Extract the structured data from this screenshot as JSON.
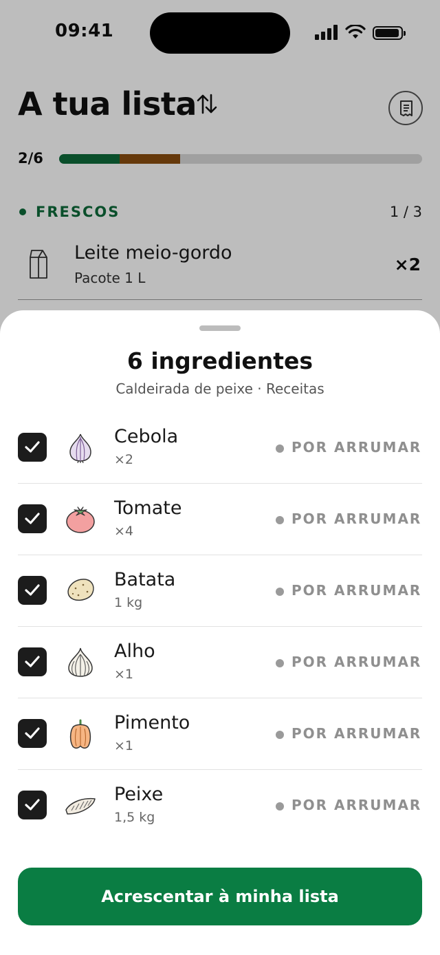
{
  "status_bar": {
    "time": "09:41"
  },
  "header": {
    "title": "A tua lista",
    "sort_icon": "sort-arrows-icon",
    "receipt_icon": "receipt-icon"
  },
  "progress": {
    "label": "2/6",
    "done_fraction": 0.167,
    "pending_fraction": 0.167
  },
  "section": {
    "title": "FRESCOS",
    "count": "1 / 3"
  },
  "list_item": {
    "name": "Leite meio-gordo",
    "detail": "Pacote 1 L",
    "qty": "×2",
    "icon": "milk-carton-icon"
  },
  "sheet": {
    "title": "6 ingredientes",
    "subtitle": "Caldeirada de peixe · Receitas",
    "ingredients": [
      {
        "name": "Cebola",
        "qty": "×2",
        "status": "POR ARRUMAR",
        "icon": "onion-icon",
        "checked": true
      },
      {
        "name": "Tomate",
        "qty": "×4",
        "status": "POR ARRUMAR",
        "icon": "tomato-icon",
        "checked": true
      },
      {
        "name": "Batata",
        "qty": "1 kg",
        "status": "POR ARRUMAR",
        "icon": "potato-icon",
        "checked": true
      },
      {
        "name": "Alho",
        "qty": "×1",
        "status": "POR ARRUMAR",
        "icon": "garlic-icon",
        "checked": true
      },
      {
        "name": "Pimento",
        "qty": "×1",
        "status": "POR ARRUMAR",
        "icon": "pepper-icon",
        "checked": true
      },
      {
        "name": "Peixe",
        "qty": "1,5 kg",
        "status": "POR ARRUMAR",
        "icon": "fish-icon",
        "checked": true
      }
    ],
    "cta_label": "Acrescentar à minha lista"
  },
  "colors": {
    "brand_green": "#0a7d43",
    "progress_green": "#0e6b3b",
    "progress_orange": "#8a4d10"
  }
}
